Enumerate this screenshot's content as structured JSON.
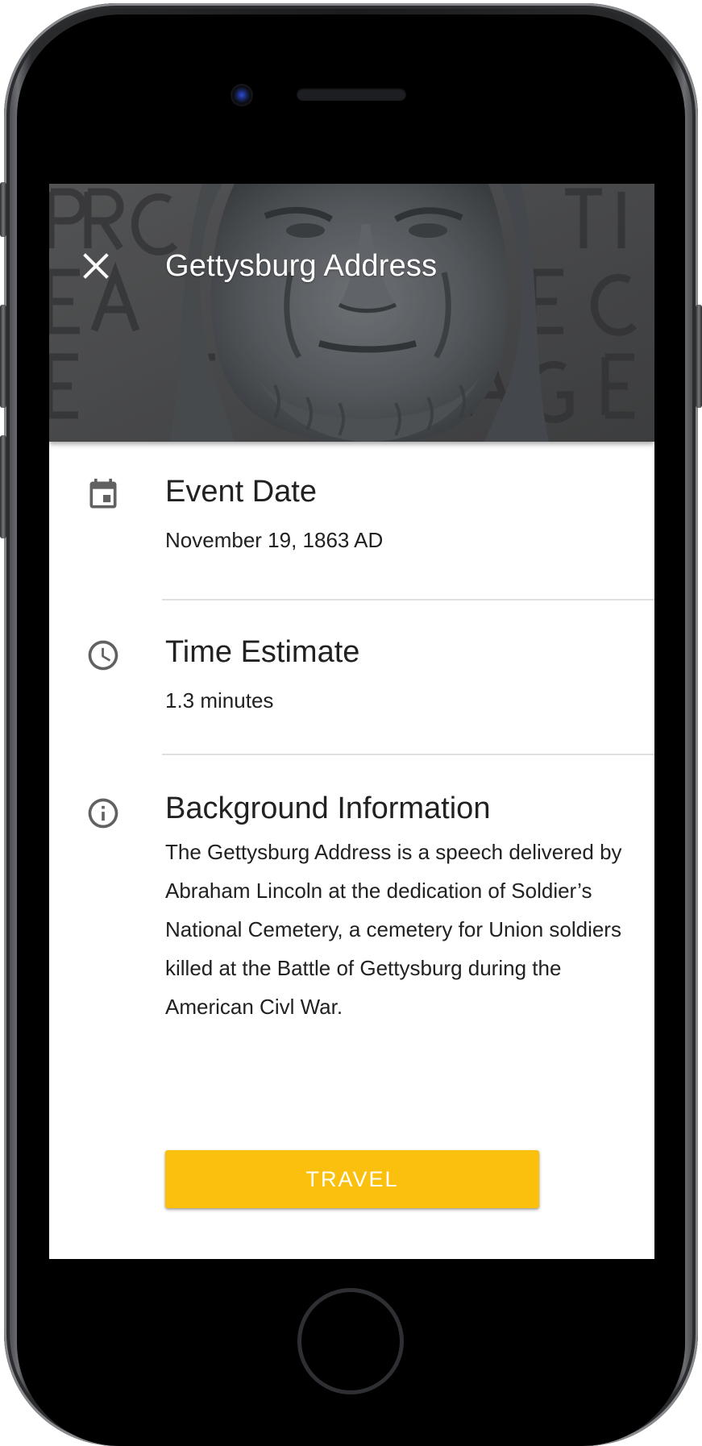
{
  "header": {
    "title": "Gettysburg Address",
    "close_icon": "close-icon"
  },
  "details": {
    "event_date": {
      "icon": "calendar-icon",
      "title": "Event Date",
      "value": "November 19, 1863 AD"
    },
    "time_estimate": {
      "icon": "clock-icon",
      "title": "Time Estimate",
      "value": "1.3 minutes"
    },
    "background": {
      "icon": "info-icon",
      "title": "Background Information",
      "text": "The Gettysburg Address is a speech delivered by Abraham Lincoln at the dedication of Soldier’s National Cemetery, a cemetery for Union soldiers killed at the Battle of Gettysburg during the American Civl War."
    }
  },
  "action": {
    "travel_label": "TRAVEL"
  },
  "colors": {
    "accent": "#fbc00e",
    "text": "#212121",
    "icon": "#616161",
    "divider": "#e0e0e0",
    "screen_background": "#ffffff"
  }
}
